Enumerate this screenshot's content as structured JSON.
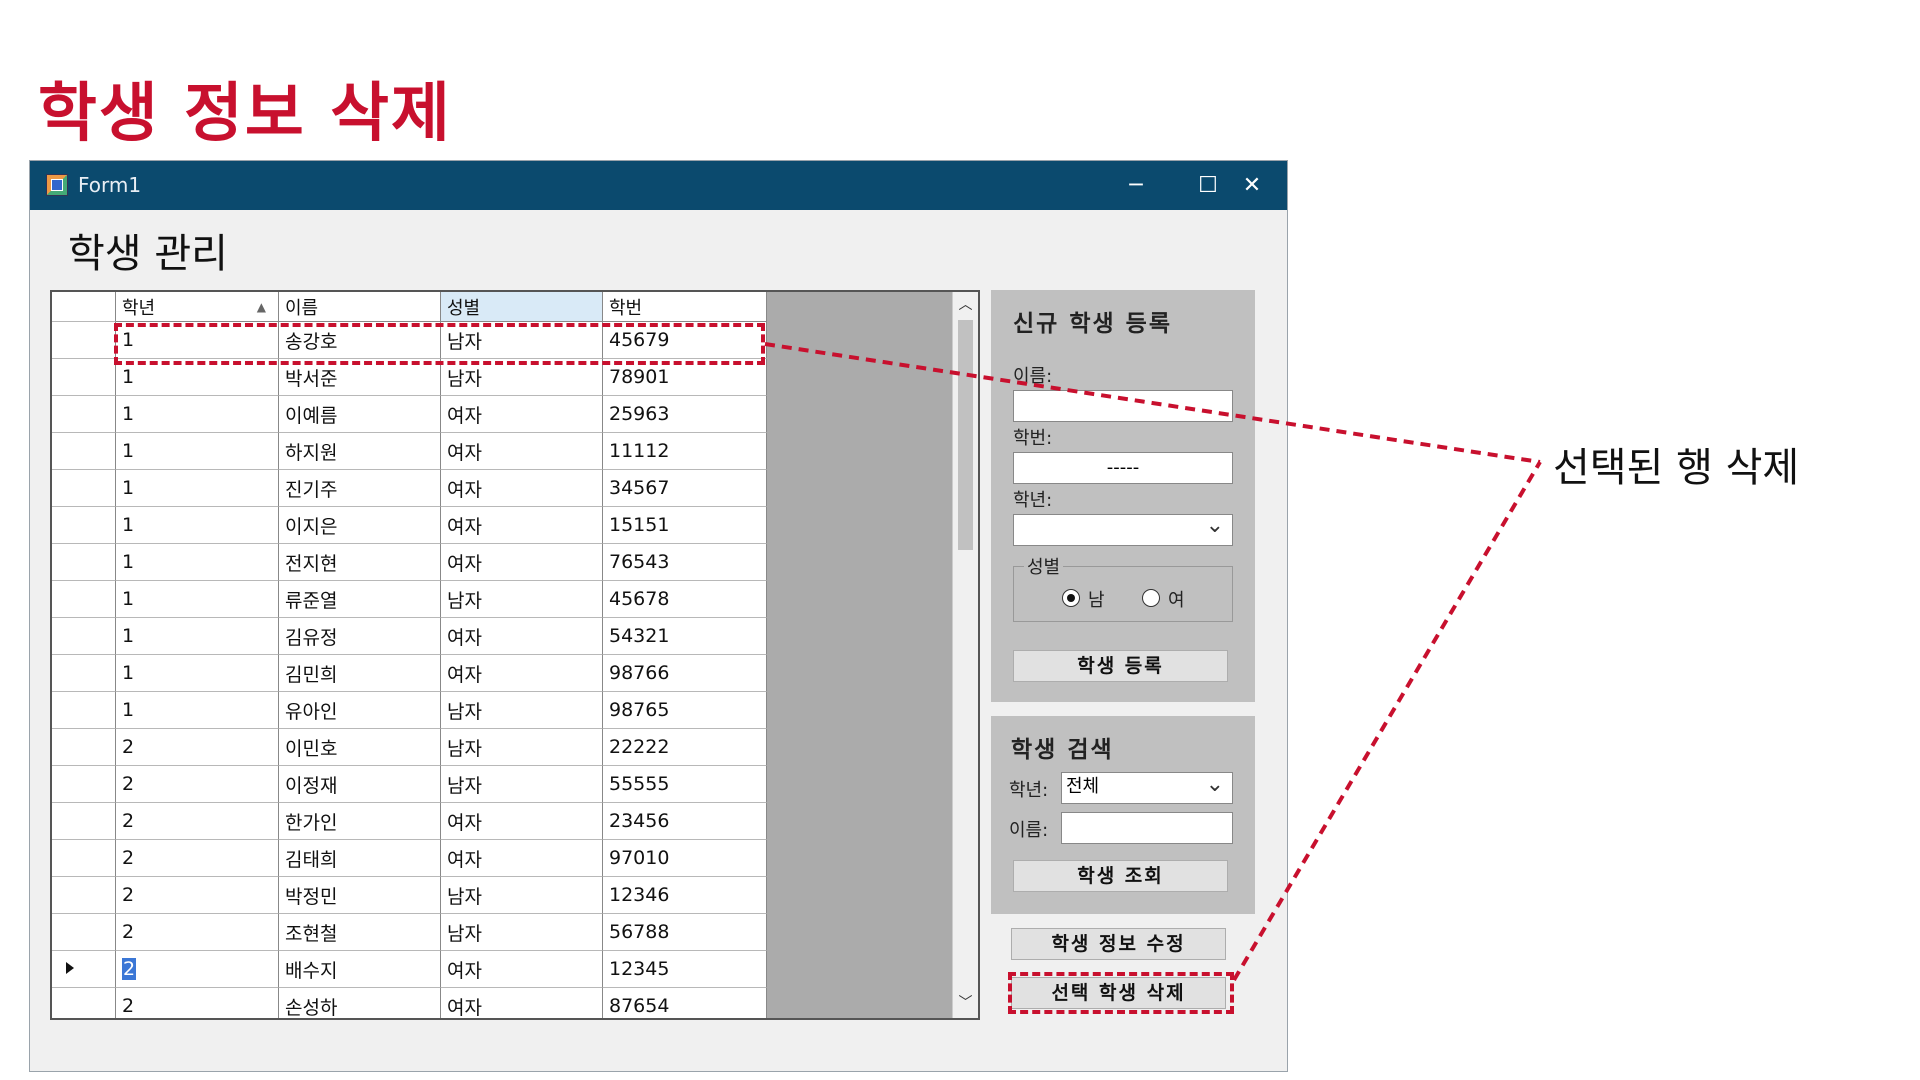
{
  "slide": {
    "title": "학생 정보 삭제"
  },
  "window": {
    "title": "Form1",
    "minimize_icon": "minimize-icon",
    "maximize_icon": "maximize-icon",
    "close_icon": "close-icon",
    "heading": "학생 관리"
  },
  "grid": {
    "columns": [
      "학년",
      "이름",
      "성별",
      "학번"
    ],
    "sorted_column": "학년",
    "rows": [
      [
        "1",
        "송강호",
        "남자",
        "45679"
      ],
      [
        "1",
        "박서준",
        "남자",
        "78901"
      ],
      [
        "1",
        "이예름",
        "여자",
        "25963"
      ],
      [
        "1",
        "하지원",
        "여자",
        "11112"
      ],
      [
        "1",
        "진기주",
        "여자",
        "34567"
      ],
      [
        "1",
        "이지은",
        "여자",
        "15151"
      ],
      [
        "1",
        "전지현",
        "여자",
        "76543"
      ],
      [
        "1",
        "류준열",
        "남자",
        "45678"
      ],
      [
        "1",
        "김유정",
        "여자",
        "54321"
      ],
      [
        "1",
        "김민희",
        "여자",
        "98766"
      ],
      [
        "1",
        "유아인",
        "남자",
        "98765"
      ],
      [
        "2",
        "이민호",
        "남자",
        "22222"
      ],
      [
        "2",
        "이정재",
        "남자",
        "55555"
      ],
      [
        "2",
        "한가인",
        "여자",
        "23456"
      ],
      [
        "2",
        "김태희",
        "여자",
        "97010"
      ],
      [
        "2",
        "박정민",
        "남자",
        "12346"
      ],
      [
        "2",
        "조현철",
        "남자",
        "56788"
      ],
      [
        "2",
        "배수지",
        "여자",
        "12345"
      ],
      [
        "2",
        "손성하",
        "여자",
        "87654"
      ]
    ],
    "current_row": 17
  },
  "register_panel": {
    "title": "신규 학생 등록",
    "name_label": "이름:",
    "name_value": "",
    "id_label": "학번:",
    "id_mask": "-----",
    "grade_label": "학년:",
    "grade_value": "",
    "gender_group_label": "성별",
    "gender_male": "남",
    "gender_female": "여",
    "gender_selected": "남",
    "submit_label": "학생 등록"
  },
  "search_panel": {
    "title": "학생 검색",
    "grade_label": "학년:",
    "grade_value": "전체",
    "name_label": "이름:",
    "name_value": "",
    "submit_label": "학생 조회"
  },
  "actions": {
    "edit_label": "학생 정보 수정",
    "delete_label": "선택 학생 삭제"
  },
  "annotation": {
    "text": "선택된 행 삭제",
    "color": "#c8102e"
  }
}
